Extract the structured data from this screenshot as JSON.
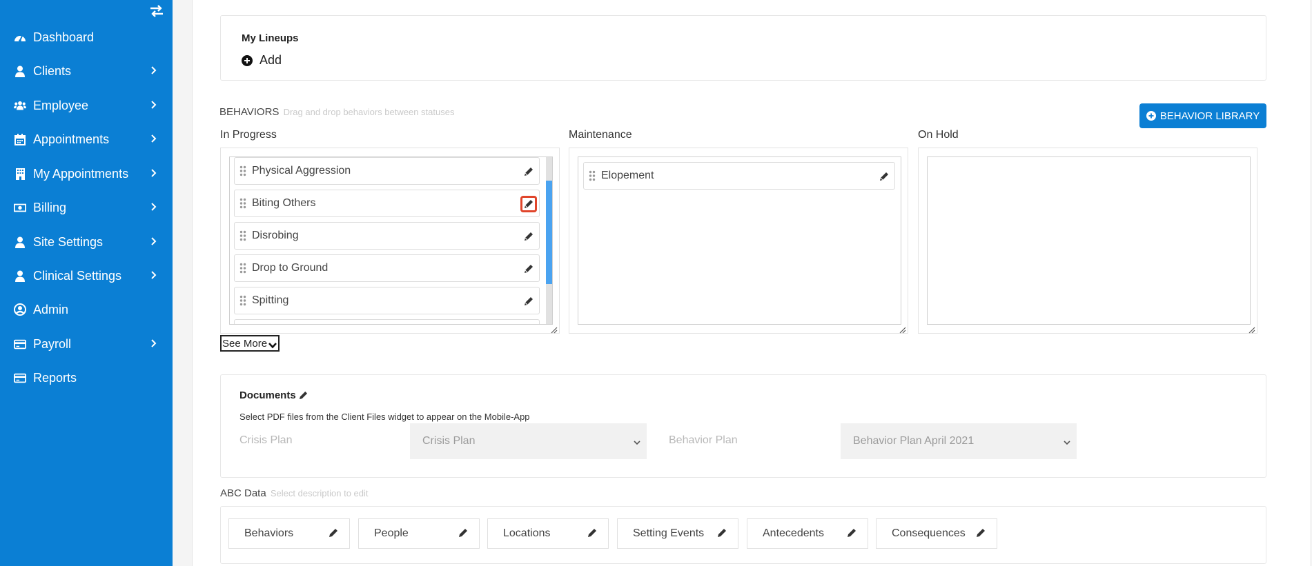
{
  "sidebar": {
    "toggle_icon": "swap-arrows-icon",
    "items": [
      {
        "label": "Dashboard",
        "icon": "dashboard-gauge-icon",
        "has_submenu": false
      },
      {
        "label": "Clients",
        "icon": "user-icon",
        "has_submenu": true
      },
      {
        "label": "Employee",
        "icon": "users-group-icon",
        "has_submenu": true
      },
      {
        "label": "Appointments",
        "icon": "calendar-icon",
        "has_submenu": true
      },
      {
        "label": "My Appointments",
        "icon": "building-icon",
        "has_submenu": true
      },
      {
        "label": "Billing",
        "icon": "money-bill-icon",
        "has_submenu": true
      },
      {
        "label": "Site Settings",
        "icon": "user-icon",
        "has_submenu": true
      },
      {
        "label": "Clinical Settings",
        "icon": "user-icon",
        "has_submenu": true
      },
      {
        "label": "Admin",
        "icon": "user-circle-icon",
        "has_submenu": false
      },
      {
        "label": "Payroll",
        "icon": "credit-card-icon",
        "has_submenu": true
      },
      {
        "label": "Reports",
        "icon": "credit-card-icon",
        "has_submenu": false
      }
    ]
  },
  "lineups": {
    "title": "My Lineups",
    "add_label": "Add"
  },
  "behaviors": {
    "title": "BEHAVIORS",
    "hint": "Drag and drop behaviors between statuses",
    "library_button": "BEHAVIOR LIBRARY",
    "see_more": "See More",
    "columns": [
      {
        "label": "In Progress",
        "items": [
          "Physical Aggression",
          "Biting Others",
          "Disrobing",
          "Drop to Ground",
          "Spitting"
        ]
      },
      {
        "label": "Maintenance",
        "items": [
          "Elopement"
        ]
      },
      {
        "label": "On Hold",
        "items": []
      }
    ]
  },
  "documents": {
    "title": "Documents",
    "description": "Select PDF files from the Client Files widget to appear on the Mobile-App",
    "crisis_label": "Crisis Plan",
    "crisis_value": "Crisis Plan",
    "behavior_label": "Behavior Plan",
    "behavior_value": "Behavior Plan April 2021"
  },
  "abc": {
    "title": "ABC Data",
    "hint": "Select description to edit",
    "tabs": [
      "Behaviors",
      "People",
      "Locations",
      "Setting Events",
      "Antecedents",
      "Consequences"
    ]
  },
  "colors": {
    "sidebar_bg": "#0b7fd4",
    "accent": "#0b7fd4",
    "highlight": "#e0452b"
  }
}
